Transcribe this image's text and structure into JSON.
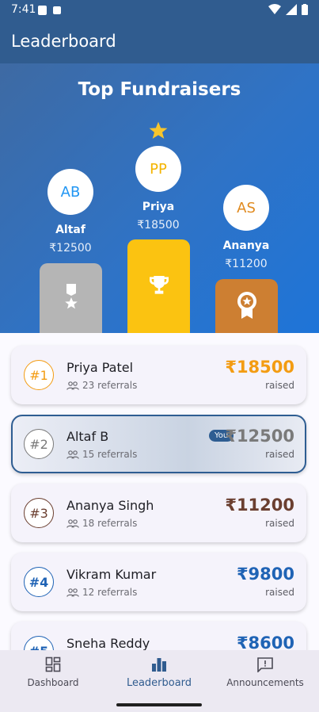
{
  "status_bar": {
    "time": "7:41"
  },
  "app_bar": {
    "title": "Leaderboard"
  },
  "hero": {
    "title": "Top Fundraisers",
    "first": {
      "initials": "PP",
      "name": "Priya",
      "amount": "₹18500",
      "color": "#f4b400"
    },
    "second": {
      "initials": "AB",
      "name": "Altaf",
      "amount": "₹12500",
      "color": "#2196f3"
    },
    "third": {
      "initials": "AS",
      "name": "Ananya",
      "amount": "₹11200",
      "color": "#e08a1f"
    }
  },
  "leaderboard": [
    {
      "rank": "#1",
      "name": "Priya Patel",
      "referrals": "23 referrals",
      "amount": "₹18500",
      "raised": "raised",
      "color": "#f39c12"
    },
    {
      "rank": "#2",
      "name": "Altaf B",
      "referrals": "15 referrals",
      "amount": "₹12500",
      "raised": "raised",
      "color": "#7a7a7a",
      "you": "You"
    },
    {
      "rank": "#3",
      "name": "Ananya Singh",
      "referrals": "18 referrals",
      "amount": "₹11200",
      "raised": "raised",
      "color": "#6b3f30"
    },
    {
      "rank": "#4",
      "name": "Vikram Kumar",
      "referrals": "12 referrals",
      "amount": "₹9800",
      "raised": "raised",
      "color": "#1f63b5"
    },
    {
      "rank": "#5",
      "name": "Sneha Reddy",
      "referrals": "",
      "amount": "₹8600",
      "raised": "",
      "color": "#1f63b5"
    }
  ],
  "bottom_nav": {
    "dashboard": "Dashboard",
    "leaderboard": "Leaderboard",
    "announcements": "Announcements"
  }
}
